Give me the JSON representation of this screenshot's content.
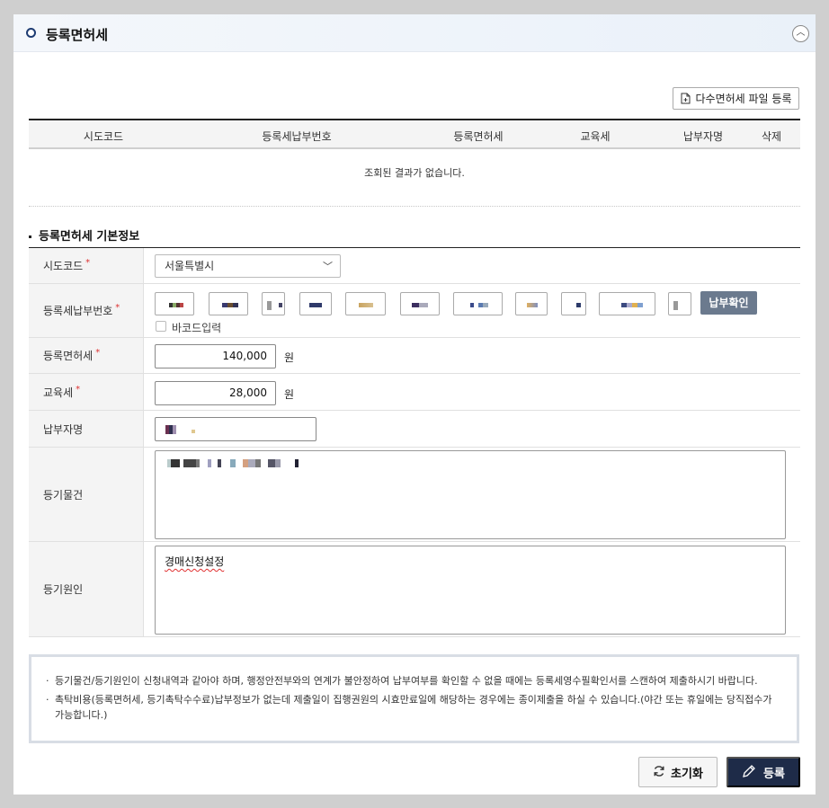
{
  "section": {
    "title": "등록면허세"
  },
  "toolbar": {
    "multi_upload_label": "다수면허세 파일 등록"
  },
  "grid": {
    "columns": [
      "시도코드",
      "등록세납부번호",
      "등록면허세",
      "교육세",
      "납부자명",
      "삭제"
    ],
    "empty_message": "조회된 결과가 없습니다."
  },
  "basic_info": {
    "title": "등록면허세 기본정보",
    "required_mark": "*",
    "sido": {
      "label": "시도코드",
      "value": "서울특별시"
    },
    "payment_no": {
      "label": "등록세납부번호",
      "confirm_button": "납부확인",
      "barcode_label": "바코드입력"
    },
    "license_tax": {
      "label": "등록면허세",
      "value": "140,000",
      "unit": "원"
    },
    "education_tax": {
      "label": "교육세",
      "value": "28,000",
      "unit": "원"
    },
    "payer": {
      "label": "납부자명"
    },
    "property": {
      "label": "등기물건"
    },
    "cause": {
      "label": "등기원인",
      "value": "경매신청설정"
    }
  },
  "notices": [
    "등기물건/등기원인이 신청내역과 같아야 하며, 행정안전부와의 연계가 불안정하여 납부여부를 확인할 수 없을 때에는 등록세영수필확인서를 스캔하여 제출하시기 바랍니다.",
    "촉탁비용(등록면허세, 등기촉탁수수료)납부정보가 없는데 제출일이 집행권원의 시효만료일에 해당하는 경우에는 종이제출을 하실 수 있습니다.(야간 또는 휴일에는 당직접수가 가능합니다.)"
  ],
  "actions": {
    "reset_label": "초기화",
    "submit_label": "등록"
  },
  "colors": {
    "primary": "#1e2b48",
    "confirm": "#6b7a8e",
    "required": "#dd3333"
  }
}
